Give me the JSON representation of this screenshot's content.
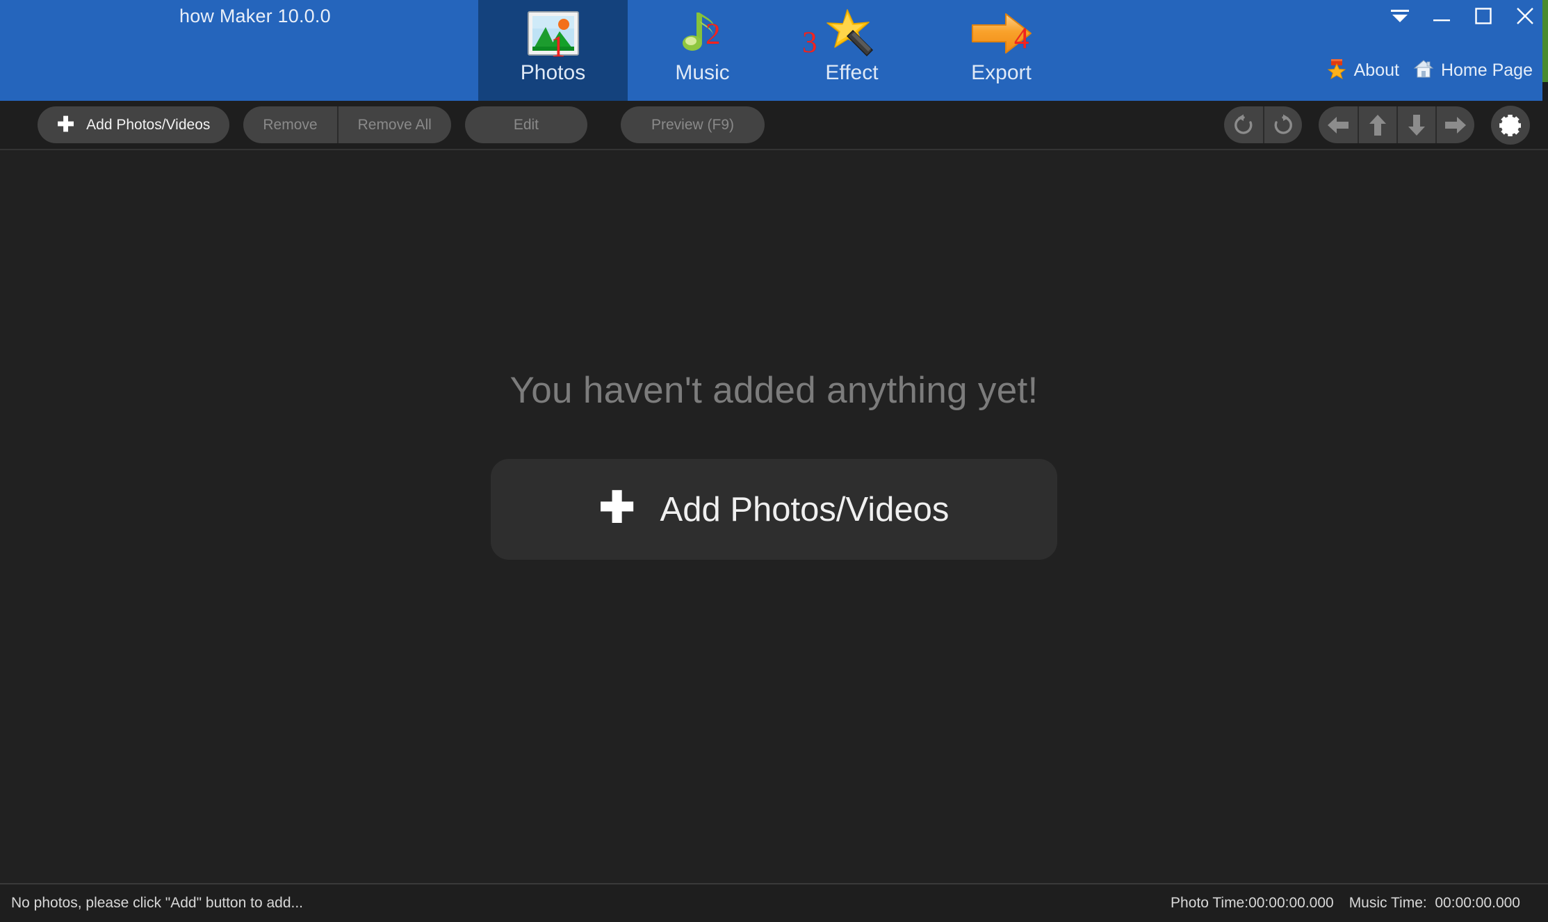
{
  "window": {
    "title": "how Maker 10.0.0",
    "header_color": "#2565bc",
    "active_tab_color": "#14427d",
    "controls": [
      {
        "name": "menu-dropdown",
        "label": ""
      },
      {
        "name": "minimize",
        "label": ""
      },
      {
        "name": "maximize",
        "label": ""
      },
      {
        "name": "close",
        "label": ""
      }
    ],
    "links": [
      {
        "label": "About",
        "icon": "star-medal-icon"
      },
      {
        "label": "Home Page",
        "icon": "home-icon"
      }
    ]
  },
  "tabs": [
    {
      "label": "Photos",
      "step": "1",
      "icon": "photo-frame-icon",
      "active": true
    },
    {
      "label": "Music",
      "step": "2",
      "icon": "music-note-icon",
      "active": false
    },
    {
      "label": "Effect",
      "step": "3",
      "icon": "magic-wand-star-icon",
      "active": false
    },
    {
      "label": "Export",
      "step": "4",
      "icon": "orange-arrow-icon",
      "active": false
    }
  ],
  "toolbar": {
    "add_label": "Add Photos/Videos",
    "add_plus": "✚",
    "remove_label": "Remove",
    "remove_all_label": "Remove All",
    "edit_label": "Edit",
    "preview_label": "Preview (F9)",
    "icons": {
      "rotate_left": "rotate-left-icon",
      "rotate_right": "rotate-right-icon",
      "move_left": "arrow-left-icon",
      "move_up": "arrow-up-icon",
      "move_down": "arrow-down-icon",
      "move_right": "arrow-right-icon",
      "settings": "gear-icon"
    }
  },
  "main": {
    "empty_message": "You haven't added anything yet!",
    "add_button_label": "Add Photos/Videos",
    "add_button_plus": "✚"
  },
  "statusbar": {
    "message": "No photos, please click \"Add\" button to add...",
    "photo_time_label": "Photo Time:00:00:00.000",
    "music_time_label": "Music Time:  00:00:00.000"
  }
}
